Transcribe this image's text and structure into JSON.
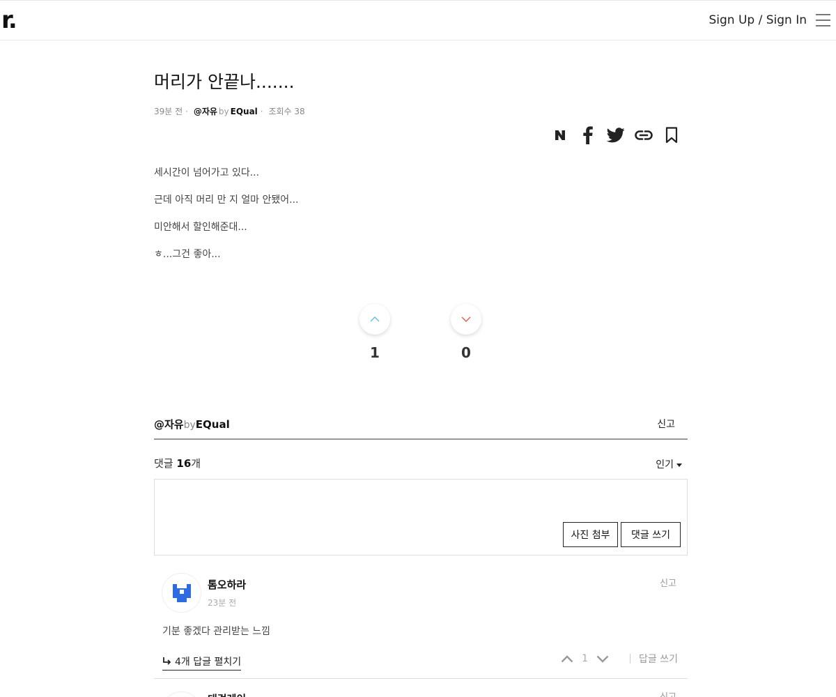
{
  "header": {
    "logo": "r.",
    "auth_label": "Sign Up / Sign In"
  },
  "post": {
    "title": "머리가 안끝나.......",
    "time": "39분 전",
    "board": "@자유",
    "by": "by",
    "author": "EQual",
    "views_label": "조회수",
    "views": "38",
    "share_icons": [
      "naver-icon",
      "facebook-icon",
      "twitter-icon",
      "link-icon",
      "bookmark-icon"
    ],
    "lines": [
      "세시간이 넘어가고 있다...",
      "근데 아직 머리 만 지 얼마 안됐어...",
      "미안해서 할인해준대...",
      "ㅎ...그건 좋아..."
    ],
    "upvotes": "1",
    "downvotes": "0"
  },
  "board_bar": {
    "board": "@자유",
    "by": "by",
    "author": "EQual",
    "report_label": "신고"
  },
  "comments_section": {
    "count_prefix": "댓글",
    "count": "16",
    "count_suffix": "개",
    "sort_label": "인기",
    "photo_button": "사진 첨부",
    "write_button": "댓글 쓰기"
  },
  "comments": [
    {
      "author": "톰오하라",
      "time": "23분 전",
      "report_label": "신고",
      "text": "기분 좋겠다 관리받는 느낌",
      "replies_label": "4개 답글 펼치기",
      "votes": "1",
      "reply_label": "답글 쓰기"
    },
    {
      "author": "대걸레이",
      "report_label": "신고"
    }
  ],
  "colors": {
    "upvote": "#5bbfd6",
    "downvote": "#e8584c",
    "avatar_blue": "#2f6be0"
  }
}
